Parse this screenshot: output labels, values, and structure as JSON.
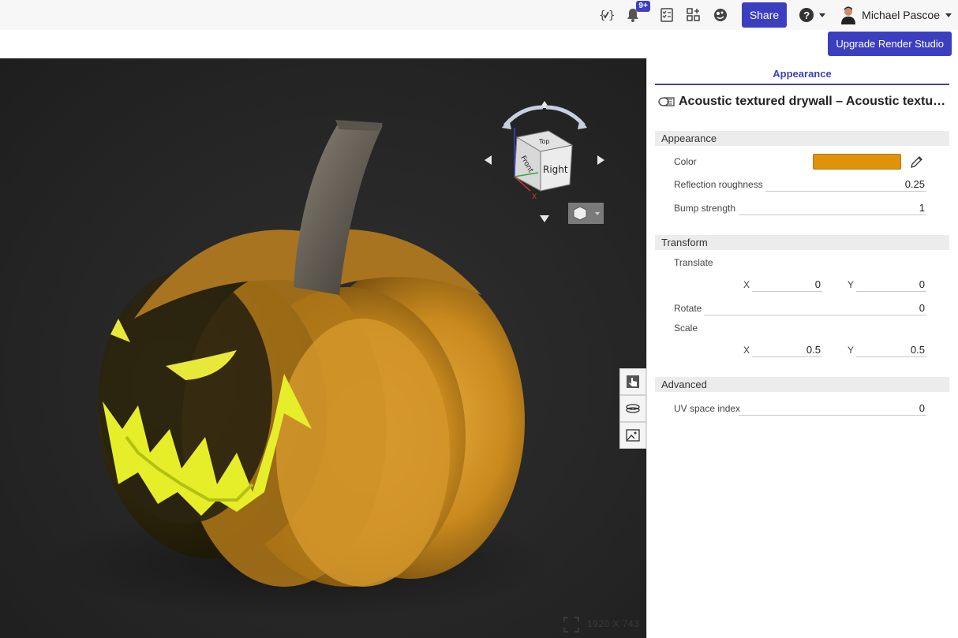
{
  "topbar": {
    "notifications_badge": "9+",
    "share_label": "Share",
    "help_label": "?",
    "user_name": "Michael Pascoe"
  },
  "upgrade_label": "Upgrade Render Studio",
  "viewport": {
    "resolution": "1920 X 743",
    "view_cube": {
      "front": "Front",
      "right": "Right",
      "top": "Top",
      "axis_x": "X"
    }
  },
  "panel": {
    "tab_label": "Appearance",
    "material_title": "Acoustic textured drywall – Acoustic textured drywall",
    "sections": {
      "appearance": {
        "header": "Appearance",
        "color_label": "Color",
        "color_value": "#e0920a",
        "reflection_label": "Reflection roughness",
        "reflection_value": "0.25",
        "bump_label": "Bump strength",
        "bump_value": "1"
      },
      "transform": {
        "header": "Transform",
        "translate_label": "Translate",
        "translate_x_label": "X",
        "translate_x": "0",
        "translate_y_label": "Y",
        "translate_y": "0",
        "rotate_label": "Rotate",
        "rotate_value": "0",
        "scale_label": "Scale",
        "scale_x_label": "X",
        "scale_x": "0.5",
        "scale_y_label": "Y",
        "scale_y": "0.5"
      },
      "advanced": {
        "header": "Advanced",
        "uv_label": "UV space index",
        "uv_value": "0"
      }
    }
  }
}
